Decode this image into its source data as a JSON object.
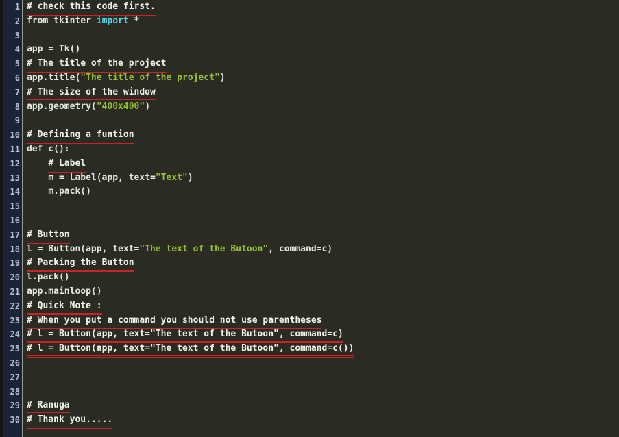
{
  "editor": {
    "theme_name": "dark-olive",
    "colors": {
      "background": "#2b2b24",
      "gutter_background": "#1b2338",
      "gutter_edge": "#15151a",
      "gutter_separator": "#9a9a93",
      "line_number": "#b6bfd0",
      "text": "#e6e6e0",
      "comment": "#f2f2ec",
      "string": "#93c32c",
      "keyword": "#55d4e8",
      "error_underline": "#cc2222"
    },
    "language": "Python",
    "first_line_number": 1,
    "last_line_number": 30,
    "lines": [
      {
        "n": "1",
        "indent": 0,
        "underline": true,
        "tokens": [
          {
            "t": "# check this code first.",
            "c": "comment"
          }
        ]
      },
      {
        "n": "2",
        "indent": 0,
        "underline": false,
        "tokens": [
          {
            "t": "from tkinter ",
            "c": "plain"
          },
          {
            "t": "import",
            "c": "kw"
          },
          {
            "t": " *",
            "c": "plain"
          }
        ]
      },
      {
        "n": "3",
        "indent": 0,
        "underline": false,
        "tokens": []
      },
      {
        "n": "4",
        "indent": 0,
        "underline": false,
        "tokens": [
          {
            "t": "app = Tk()",
            "c": "plain"
          }
        ]
      },
      {
        "n": "5",
        "indent": 0,
        "underline": true,
        "tokens": [
          {
            "t": "# The title of the project",
            "c": "comment"
          }
        ]
      },
      {
        "n": "6",
        "indent": 0,
        "underline": false,
        "tokens": [
          {
            "t": "app.title(",
            "c": "plain"
          },
          {
            "t": "\"The title of the project\"",
            "c": "str"
          },
          {
            "t": ")",
            "c": "plain"
          }
        ]
      },
      {
        "n": "7",
        "indent": 0,
        "underline": true,
        "tokens": [
          {
            "t": "# The size of the window",
            "c": "comment"
          }
        ]
      },
      {
        "n": "8",
        "indent": 0,
        "underline": false,
        "tokens": [
          {
            "t": "app.geometry(",
            "c": "plain"
          },
          {
            "t": "\"400x400\"",
            "c": "str"
          },
          {
            "t": ")",
            "c": "plain"
          }
        ]
      },
      {
        "n": "9",
        "indent": 0,
        "underline": false,
        "tokens": []
      },
      {
        "n": "10",
        "indent": 0,
        "underline": true,
        "tokens": [
          {
            "t": "# Defining a funtion",
            "c": "comment"
          }
        ]
      },
      {
        "n": "11",
        "indent": 0,
        "underline": false,
        "tokens": [
          {
            "t": "def c():",
            "c": "plain"
          }
        ]
      },
      {
        "n": "12",
        "indent": 4,
        "underline": true,
        "tokens": [
          {
            "t": "# Label",
            "c": "comment"
          }
        ]
      },
      {
        "n": "13",
        "indent": 4,
        "underline": false,
        "tokens": [
          {
            "t": "m = Label(app, text=",
            "c": "plain"
          },
          {
            "t": "\"Text\"",
            "c": "str"
          },
          {
            "t": ")",
            "c": "plain"
          }
        ]
      },
      {
        "n": "14",
        "indent": 4,
        "underline": false,
        "tokens": [
          {
            "t": "m.pack()",
            "c": "plain"
          }
        ]
      },
      {
        "n": "15",
        "indent": 0,
        "underline": false,
        "tokens": []
      },
      {
        "n": "16",
        "indent": 0,
        "underline": false,
        "tokens": []
      },
      {
        "n": "17",
        "indent": 0,
        "underline": true,
        "tokens": [
          {
            "t": "# Button",
            "c": "comment"
          }
        ]
      },
      {
        "n": "18",
        "indent": 0,
        "underline": false,
        "tokens": [
          {
            "t": "l = Button(app, text=",
            "c": "plain"
          },
          {
            "t": "\"The text of the Butoon\"",
            "c": "str"
          },
          {
            "t": ", command=c)",
            "c": "plain"
          }
        ]
      },
      {
        "n": "19",
        "indent": 0,
        "underline": true,
        "tokens": [
          {
            "t": "# Packing the Button",
            "c": "comment"
          }
        ]
      },
      {
        "n": "20",
        "indent": 0,
        "underline": false,
        "tokens": [
          {
            "t": "l.pack()",
            "c": "plain"
          }
        ]
      },
      {
        "n": "21",
        "indent": 0,
        "underline": false,
        "tokens": [
          {
            "t": "app.mainloop()",
            "c": "plain"
          }
        ]
      },
      {
        "n": "22",
        "indent": 0,
        "underline": true,
        "tokens": [
          {
            "t": "# Quick Note :",
            "c": "comment"
          }
        ]
      },
      {
        "n": "23",
        "indent": 0,
        "underline": true,
        "tokens": [
          {
            "t": "# When you put a command you should not use parentheses",
            "c": "comment"
          }
        ]
      },
      {
        "n": "24",
        "indent": 0,
        "underline": true,
        "tokens": [
          {
            "t": "# l = Button(app, text=\"The text of the Butoon\", command=c)",
            "c": "comment"
          }
        ]
      },
      {
        "n": "25",
        "indent": 0,
        "underline": true,
        "tokens": [
          {
            "t": "# l = Button(app, text=\"The text of the Butoon\", command=c())",
            "c": "comment"
          }
        ]
      },
      {
        "n": "26",
        "indent": 0,
        "underline": false,
        "tokens": []
      },
      {
        "n": "27",
        "indent": 0,
        "underline": false,
        "tokens": []
      },
      {
        "n": "28",
        "indent": 0,
        "underline": false,
        "tokens": []
      },
      {
        "n": "29",
        "indent": 0,
        "underline": true,
        "tokens": [
          {
            "t": "# Ranuga",
            "c": "comment"
          }
        ]
      },
      {
        "n": "30",
        "indent": 0,
        "underline": true,
        "tokens": [
          {
            "t": "# Thank you.....",
            "c": "comment"
          }
        ]
      }
    ]
  }
}
